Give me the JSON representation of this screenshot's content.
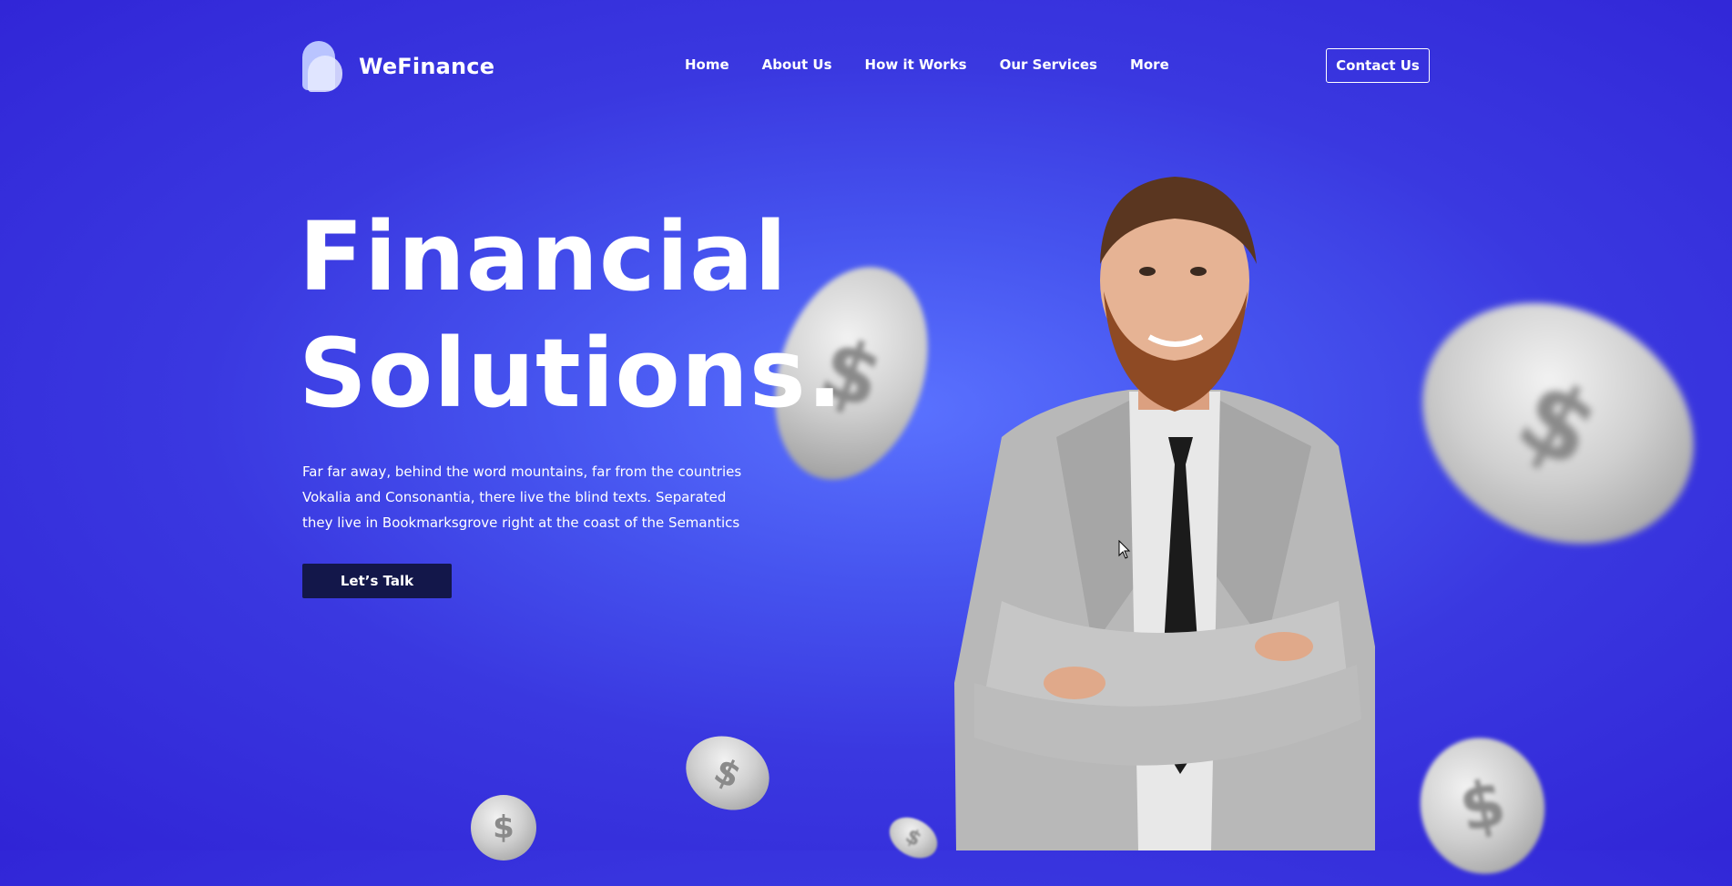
{
  "brand": {
    "name": "WeFinance"
  },
  "nav": {
    "items": [
      "Home",
      "About Us",
      "How it Works",
      "Our Services",
      "More"
    ],
    "contact_label": "Contact Us"
  },
  "hero": {
    "title_line1": "Financial",
    "title_line2": "Solutions.",
    "description": "Far far away, behind the word mountains, far from the countries Vokalia and Consonantia, there live the blind texts. Separated they live in Bookmarksgrove right at the coast of the Semantics",
    "cta_label": "Let’s Talk"
  },
  "coins": {
    "symbol": "$"
  },
  "colors": {
    "background": "#3a38e0",
    "cta_background": "#13174a",
    "text": "#ffffff"
  }
}
